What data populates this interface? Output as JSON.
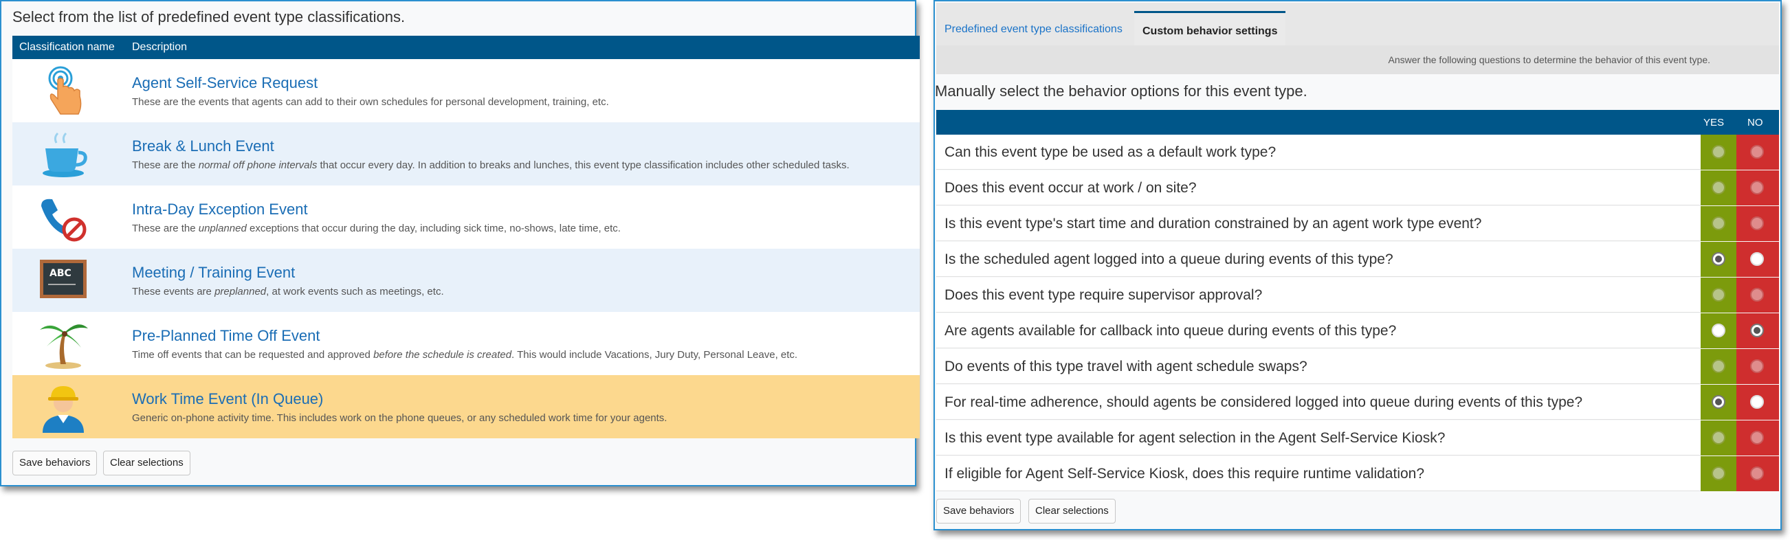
{
  "left": {
    "title": "Select from the list of predefined event type classifications.",
    "columns": {
      "name": "Classification name",
      "description": "Description"
    },
    "rows": [
      {
        "name": "Agent Self-Service Request",
        "desc_before": "These are the events that agents can add to their own schedules for personal development, training, etc.",
        "desc_em": "",
        "desc_after": ""
      },
      {
        "name": "Break & Lunch Event",
        "desc_before": "These are the ",
        "desc_em": "normal off phone intervals",
        "desc_after": " that occur every day. In addition to breaks and lunches, this event type classification includes other scheduled tasks."
      },
      {
        "name": "Intra-Day Exception Event",
        "desc_before": "These are the ",
        "desc_em": "unplanned",
        "desc_after": " exceptions that occur during the day, including sick time, no-shows, late time, etc."
      },
      {
        "name": "Meeting / Training Event",
        "desc_before": "These events are ",
        "desc_em": "preplanned",
        "desc_after": ", at work events such as meetings, etc."
      },
      {
        "name": "Pre-Planned Time Off Event",
        "desc_before": "Time off events that can be requested and approved ",
        "desc_em": "before the schedule is created",
        "desc_after": ". This would include Vacations, Jury Duty, Personal Leave, etc."
      },
      {
        "name": "Work Time Event (In Queue)",
        "desc_before": "Generic on-phone activity time. This includes work on the phone queues, or any scheduled work time for your agents.",
        "desc_em": "",
        "desc_after": ""
      }
    ],
    "icons": [
      "touch-hand-icon",
      "coffee-cup-icon",
      "phone-cancel-icon",
      "chalkboard-icon",
      "palm-tree-icon",
      "worker-hardhat-icon"
    ],
    "save_label": "Save behaviors",
    "clear_label": "Clear selections"
  },
  "right": {
    "tabs": [
      {
        "label": "Predefined event type classifications",
        "active": false
      },
      {
        "label": "Custom behavior settings",
        "active": true
      }
    ],
    "info": "Answer the following questions to determine the behavior of this event type.",
    "title": "Manually select the behavior options for this event type.",
    "yes_label": "YES",
    "no_label": "NO",
    "questions": [
      {
        "text": "Can this event type be used as a default work type?",
        "yes": "disabled",
        "no": "disabled"
      },
      {
        "text": "Does this event occur at work / on site?",
        "yes": "disabled",
        "no": "disabled"
      },
      {
        "text": "Is this event type's start time and duration constrained by an agent work type event?",
        "yes": "disabled",
        "no": "disabled"
      },
      {
        "text": "Is the scheduled agent logged into a queue during events of this type?",
        "yes": "checked",
        "no": "empty"
      },
      {
        "text": "Does this event type require supervisor approval?",
        "yes": "disabled",
        "no": "disabled"
      },
      {
        "text": "Are agents available for callback into queue during events of this type?",
        "yes": "empty",
        "no": "checked"
      },
      {
        "text": "Do events of this type travel with agent schedule swaps?",
        "yes": "disabled",
        "no": "disabled"
      },
      {
        "text": "For real-time adherence, should agents be considered logged into queue during events of this type?",
        "yes": "checked",
        "no": "empty"
      },
      {
        "text": "Is this event type available for agent selection in the Agent Self-Service Kiosk?",
        "yes": "disabled",
        "no": "disabled"
      },
      {
        "text": "If eligible for Agent Self-Service Kiosk, does this require runtime validation?",
        "yes": "disabled",
        "no": "disabled"
      }
    ],
    "save_label": "Save behaviors",
    "clear_label": "Clear selections"
  },
  "colors": {
    "header": "#005689",
    "selected_row": "#fcd88e",
    "yes": "#7c9b0c",
    "no": "#cf2e2e",
    "link": "#1a6db5"
  }
}
